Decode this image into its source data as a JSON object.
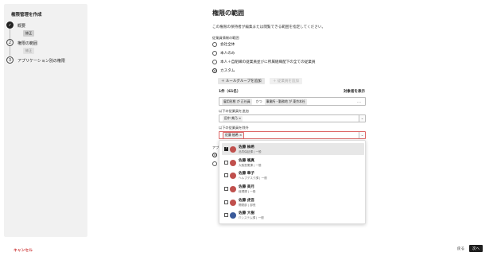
{
  "sidebar": {
    "title": "権限管理を作成",
    "steps": [
      {
        "num": "✓",
        "label": "概要",
        "button": "修正"
      },
      {
        "num": "2",
        "label": "権限の範囲",
        "button": "修正"
      },
      {
        "num": "3",
        "label": "アプリケーション別の権限"
      }
    ]
  },
  "main": {
    "title": "権限の範囲",
    "description": "この権限の保持者が編集または閲覧できる範囲を指定してください。",
    "section_label": "従業員情報の範囲",
    "options": [
      "会社全体",
      "本人のみ",
      "本人＋自組織の従業員並びに所属組織配下の全ての従業員",
      "カスタム"
    ],
    "selected_option": "カスタム",
    "add_rule_group": "＋ ルールグループを追加",
    "add_employee": "＋ 従業員を追加",
    "count": "1件（61名）",
    "show_targets": "対象者を表示",
    "rule": {
      "chip1": "雇用形態 が 正社員",
      "joiner": "かつ",
      "chip2": "事業所・勤務地 が 東京本社",
      "menu": "…"
    },
    "add_label": "以下の従業員を追加",
    "add_value": "田中 美乃 ×",
    "exclude_label": "以下の従業員を除外",
    "exclude_value": "佐藤 柚希 ×",
    "behind_label": "アプ"
  },
  "dropdown": {
    "items": [
      {
        "name": "佐藤 柚希",
        "dept": "品質保証課 | 一般",
        "checked": true,
        "color": "#c0504d"
      },
      {
        "name": "佐藤 颯真",
        "dept": "大阪営業課 | 一般",
        "checked": false,
        "color": "#c0504d"
      },
      {
        "name": "佐藤 華子",
        "dept": "ヘルプデスク課 | 一般",
        "checked": false,
        "color": "#c0504d"
      },
      {
        "name": "佐藤 美月",
        "dept": "経理課 | 一般",
        "checked": false,
        "color": "#c0504d"
      },
      {
        "name": "佐藤 虎吾",
        "dept": "開発部 | 部長",
        "checked": false,
        "color": "#c0504d"
      },
      {
        "name": "佐藤 大樹",
        "dept": "ITシステム課 | 一般",
        "checked": false,
        "color": "#3a5a9a"
      }
    ]
  },
  "footer": {
    "cancel": "キャンセル",
    "back": "戻る",
    "next": "次へ"
  }
}
